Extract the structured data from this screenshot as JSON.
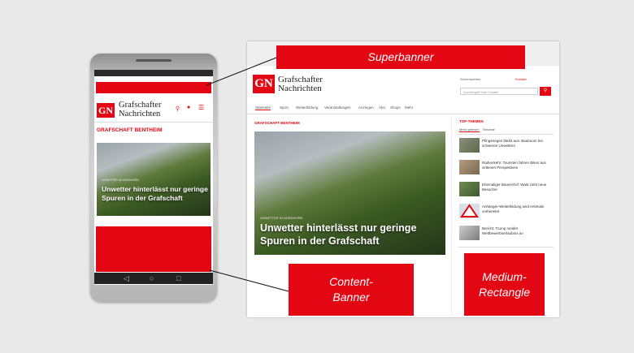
{
  "banners": {
    "superbanner": "Superbanner",
    "content_banner": "Content-\nBanner",
    "medium_rectangle": "Medium-\nRectangle"
  },
  "logo": {
    "abbr": "GN",
    "line1": "Grafschafter",
    "line2": "Nachrichten"
  },
  "phone": {
    "section": "GRAFSCHAFT BENTHEIM",
    "kicker": "UNWETTER IN NORDHORN",
    "headline": "Unwetter hinterlässt nur geringe Spuren in der Grafschaft"
  },
  "desktop": {
    "nav": [
      "Startseite",
      "Sport",
      "Weiterbildung",
      "Veranstaltungen",
      "Anzeigen",
      "Abo",
      "Shops",
      "Mehr"
    ],
    "search_placeholder": "Suchbegriff oder Ortsteil",
    "section": "GRAFSCHAFT BENTHEIM",
    "kicker": "UNWETTER IN NORDHORN",
    "headline": "Unwetter hinterlässt nur geringe Spuren in der Grafschaft",
    "top_title": "TOP-THEMEN",
    "top_tabs": [
      "Meist gelesen",
      "Neueste"
    ],
    "top_items": [
      "Pfingstregen bleibt aus: Bauboom bei schweren Unwettern",
      "Radverkehr: Touristen fahren Bikes aus seltenen Perspektiven",
      "Ehemaliger Bauernhof: Wald zieht neue Besucher",
      "Anhänger-Weiterbildung wird erstmals vorbereitet",
      "Bericht: Trump meldet Wettbewerbserlaubnis an"
    ],
    "header_link1": "Sehenswertes",
    "header_link2": "Kontakt"
  }
}
